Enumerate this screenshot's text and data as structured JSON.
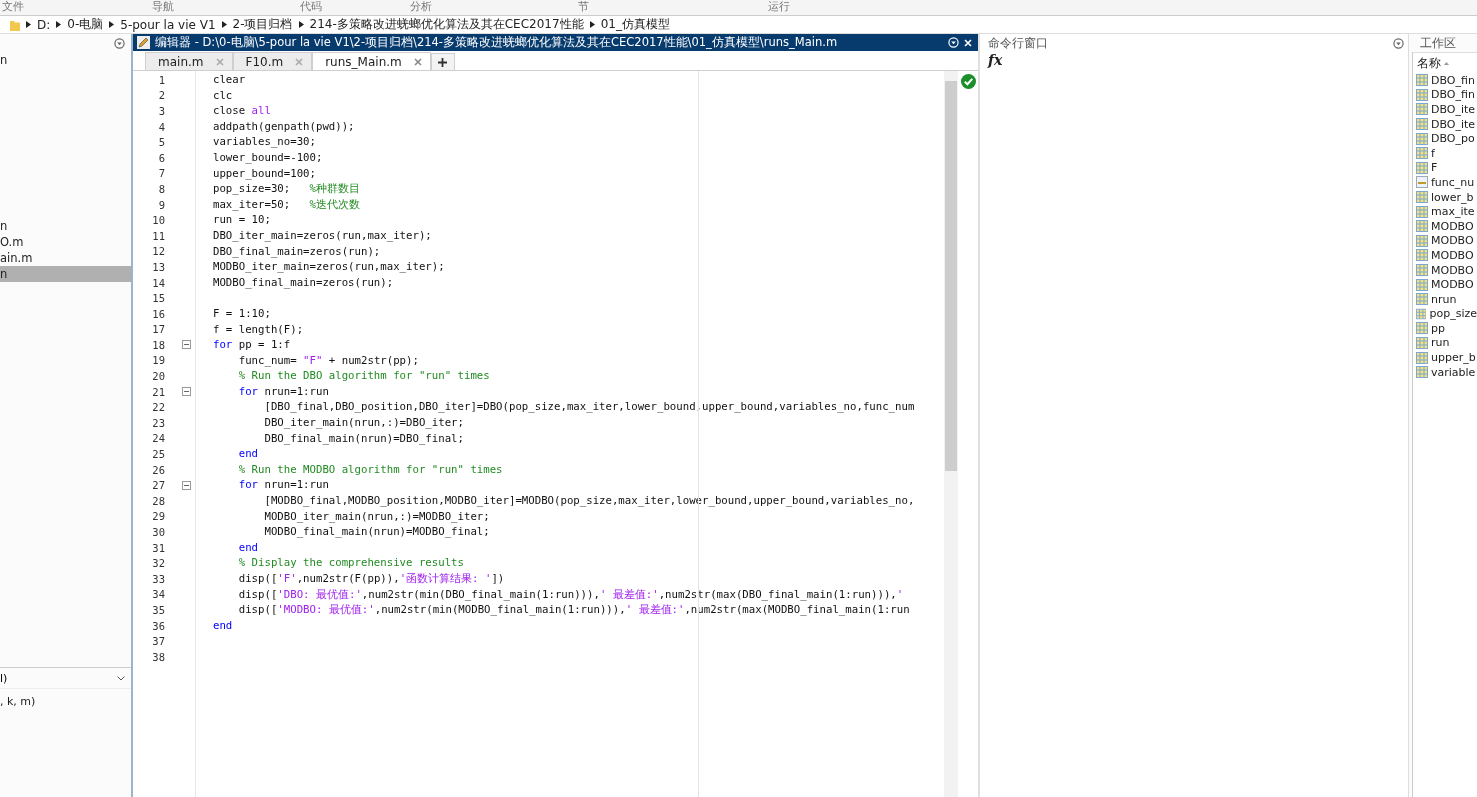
{
  "toolstrip": {
    "labels": [
      "文件",
      "导航",
      "代码",
      "分析",
      "节",
      "运行"
    ]
  },
  "address_bar": {
    "segments": [
      "D:",
      "0-电脑",
      "5-pour la vie V1",
      "2-项目归档",
      "214-多策略改进蜣螂优化算法及其在CEC2017性能",
      "01_仿真模型"
    ]
  },
  "file_browser": {
    "items": [
      {
        "name": "n",
        "selected": false
      },
      {
        "name": "n",
        "selected": false
      },
      {
        "name": "O.m",
        "selected": false
      },
      {
        "name": "ain.m",
        "selected": false
      },
      {
        "name": "n",
        "selected": true
      }
    ],
    "details_select": "l)",
    "details_text": ", k, m)"
  },
  "editor": {
    "title": "编辑器 - D:\\0-电脑\\5-pour la vie V1\\2-项目归档\\214-多策略改进蜣螂优化算法及其在CEC2017性能\\01_仿真模型\\runs_Main.m",
    "tabs": [
      {
        "label": "main.m",
        "selected": false
      },
      {
        "label": "F10.m",
        "selected": false
      },
      {
        "label": "runs_Main.m",
        "selected": true
      }
    ],
    "lines": [
      {
        "number": "1",
        "fold": false,
        "tokens": [
          {
            "kind": "plain",
            "text": "clear"
          }
        ]
      },
      {
        "number": "2",
        "fold": false,
        "tokens": [
          {
            "kind": "plain",
            "text": "clc"
          }
        ]
      },
      {
        "number": "3",
        "fold": false,
        "tokens": [
          {
            "kind": "plain",
            "text": "close "
          },
          {
            "kind": "string",
            "text": "all"
          }
        ]
      },
      {
        "number": "4",
        "fold": false,
        "tokens": [
          {
            "kind": "plain",
            "text": "addpath(genpath(pwd));"
          }
        ]
      },
      {
        "number": "5",
        "fold": false,
        "tokens": [
          {
            "kind": "plain",
            "text": "variables_no=30;"
          }
        ]
      },
      {
        "number": "6",
        "fold": false,
        "tokens": [
          {
            "kind": "plain",
            "text": "lower_bound=-100;"
          }
        ]
      },
      {
        "number": "7",
        "fold": false,
        "tokens": [
          {
            "kind": "plain",
            "text": "upper_bound=100;"
          }
        ]
      },
      {
        "number": "8",
        "fold": false,
        "tokens": [
          {
            "kind": "plain",
            "text": "pop_size=30;   "
          },
          {
            "kind": "comment",
            "text": "%种群数目"
          }
        ]
      },
      {
        "number": "9",
        "fold": false,
        "tokens": [
          {
            "kind": "plain",
            "text": "max_iter=50;   "
          },
          {
            "kind": "comment",
            "text": "%迭代次数"
          }
        ]
      },
      {
        "number": "10",
        "fold": false,
        "tokens": [
          {
            "kind": "plain",
            "text": "run = 10;"
          }
        ]
      },
      {
        "number": "11",
        "fold": false,
        "tokens": [
          {
            "kind": "plain",
            "text": "DBO_iter_main=zeros(run,max_iter);"
          }
        ]
      },
      {
        "number": "12",
        "fold": false,
        "tokens": [
          {
            "kind": "plain",
            "text": "DBO_final_main=zeros(run);"
          }
        ]
      },
      {
        "number": "13",
        "fold": false,
        "tokens": [
          {
            "kind": "plain",
            "text": "MODBO_iter_main=zeros(run,max_iter);"
          }
        ]
      },
      {
        "number": "14",
        "fold": false,
        "tokens": [
          {
            "kind": "plain",
            "text": "MODBO_final_main=zeros(run);"
          }
        ]
      },
      {
        "number": "15",
        "fold": false
      },
      {
        "number": "16",
        "fold": false,
        "tokens": [
          {
            "kind": "plain",
            "text": "F = 1:10;"
          }
        ]
      },
      {
        "number": "17",
        "fold": false,
        "tokens": [
          {
            "kind": "plain",
            "text": "f = length(F);"
          }
        ]
      },
      {
        "number": "18",
        "fold": true,
        "tokens": [
          {
            "kind": "keyword",
            "text": "for"
          },
          {
            "kind": "plain",
            "text": " pp = 1:f"
          }
        ]
      },
      {
        "number": "19",
        "fold": false,
        "tokens": [
          {
            "kind": "plain",
            "text": "    func_num= "
          },
          {
            "kind": "string",
            "text": "\"F\""
          },
          {
            "kind": "plain",
            "text": " + num2str(pp);"
          }
        ]
      },
      {
        "number": "20",
        "fold": false,
        "tokens": [
          {
            "kind": "comment",
            "text": "    % Run the DBO algorithm for \"run\" times"
          }
        ]
      },
      {
        "number": "21",
        "fold": true,
        "tokens": [
          {
            "kind": "keyword",
            "text": "    for"
          },
          {
            "kind": "plain",
            "text": " nrun=1:run"
          }
        ]
      },
      {
        "number": "22",
        "fold": false,
        "tokens": [
          {
            "kind": "plain",
            "text": "        [DBO_final,DBO_position,DBO_iter]=DBO(pop_size,max_iter,lower_bound,upper_bound,variables_no,func_num"
          }
        ]
      },
      {
        "number": "23",
        "fold": false,
        "tokens": [
          {
            "kind": "plain",
            "text": "        DBO_iter_main(nrun,:)=DBO_iter;"
          }
        ]
      },
      {
        "number": "24",
        "fold": false,
        "tokens": [
          {
            "kind": "plain",
            "text": "        DBO_final_main(nrun)=DBO_final;"
          }
        ]
      },
      {
        "number": "25",
        "fold": false,
        "tokens": [
          {
            "kind": "keyword",
            "text": "    end"
          }
        ]
      },
      {
        "number": "26",
        "fold": false,
        "tokens": [
          {
            "kind": "comment",
            "text": "    % Run the MODBO algorithm for \"run\" times"
          }
        ]
      },
      {
        "number": "27",
        "fold": true,
        "tokens": [
          {
            "kind": "keyword",
            "text": "    for"
          },
          {
            "kind": "plain",
            "text": " nrun=1:run"
          }
        ]
      },
      {
        "number": "28",
        "fold": false,
        "tokens": [
          {
            "kind": "plain",
            "text": "        [MODBO_final,MODBO_position,MODBO_iter]=MODBO(pop_size,max_iter,lower_bound,upper_bound,variables_no,"
          }
        ]
      },
      {
        "number": "29",
        "fold": false,
        "tokens": [
          {
            "kind": "plain",
            "text": "        MODBO_iter_main(nrun,:)=MODBO_iter;"
          }
        ]
      },
      {
        "number": "30",
        "fold": false,
        "tokens": [
          {
            "kind": "plain",
            "text": "        MODBO_final_main(nrun)=MODBO_final;"
          }
        ]
      },
      {
        "number": "31",
        "fold": false,
        "tokens": [
          {
            "kind": "keyword",
            "text": "    end"
          }
        ]
      },
      {
        "number": "32",
        "fold": false,
        "tokens": [
          {
            "kind": "comment",
            "text": "    % Display the comprehensive results"
          }
        ]
      },
      {
        "number": "33",
        "fold": false,
        "tokens": [
          {
            "kind": "plain",
            "text": "    disp(["
          },
          {
            "kind": "string",
            "text": "'F'"
          },
          {
            "kind": "plain",
            "text": ",num2str(F(pp)),"
          },
          {
            "kind": "string",
            "text": "'函数计算结果: '"
          },
          {
            "kind": "plain",
            "text": "])"
          }
        ]
      },
      {
        "number": "34",
        "fold": false,
        "tokens": [
          {
            "kind": "plain",
            "text": "    disp(["
          },
          {
            "kind": "string",
            "text": "'DBO: 最优值:'"
          },
          {
            "kind": "plain",
            "text": ",num2str(min(DBO_final_main(1:run))),"
          },
          {
            "kind": "string",
            "text": "' 最差值:'"
          },
          {
            "kind": "plain",
            "text": ",num2str(max(DBO_final_main(1:run))),"
          },
          {
            "kind": "string",
            "text": "'"
          }
        ]
      },
      {
        "number": "35",
        "fold": false,
        "tokens": [
          {
            "kind": "plain",
            "text": "    disp(["
          },
          {
            "kind": "string",
            "text": "'MODBO: 最优值:'"
          },
          {
            "kind": "plain",
            "text": ",num2str(min(MODBO_final_main(1:run))),"
          },
          {
            "kind": "string",
            "text": "' 最差值:'"
          },
          {
            "kind": "plain",
            "text": ",num2str(max(MODBO_final_main(1:run"
          }
        ]
      },
      {
        "number": "36",
        "fold": false,
        "tokens": [
          {
            "kind": "keyword",
            "text": "end"
          }
        ]
      },
      {
        "number": "37",
        "fold": false
      },
      {
        "number": "38",
        "fold": false
      }
    ]
  },
  "command_window": {
    "title": "命令行窗口",
    "prompt": "fx"
  },
  "workspace": {
    "title": "工作区",
    "column": "名称",
    "items": [
      {
        "kind": "matrix",
        "name": "DBO_fin"
      },
      {
        "kind": "matrix",
        "name": "DBO_fin"
      },
      {
        "kind": "matrix",
        "name": "DBO_ite"
      },
      {
        "kind": "matrix",
        "name": "DBO_ite"
      },
      {
        "kind": "matrix",
        "name": "DBO_po"
      },
      {
        "kind": "matrix",
        "name": "f"
      },
      {
        "kind": "matrix",
        "name": "F"
      },
      {
        "kind": "string",
        "name": "func_nu"
      },
      {
        "kind": "matrix",
        "name": "lower_b"
      },
      {
        "kind": "matrix",
        "name": "max_ite"
      },
      {
        "kind": "matrix",
        "name": "MODBO"
      },
      {
        "kind": "matrix",
        "name": "MODBO"
      },
      {
        "kind": "matrix",
        "name": "MODBO"
      },
      {
        "kind": "matrix",
        "name": "MODBO"
      },
      {
        "kind": "matrix",
        "name": "MODBO"
      },
      {
        "kind": "matrix",
        "name": "nrun"
      },
      {
        "kind": "matrix",
        "name": "pop_size"
      },
      {
        "kind": "matrix",
        "name": "pp"
      },
      {
        "kind": "matrix",
        "name": "run"
      },
      {
        "kind": "matrix",
        "name": "upper_b"
      },
      {
        "kind": "matrix",
        "name": "variable"
      }
    ]
  }
}
